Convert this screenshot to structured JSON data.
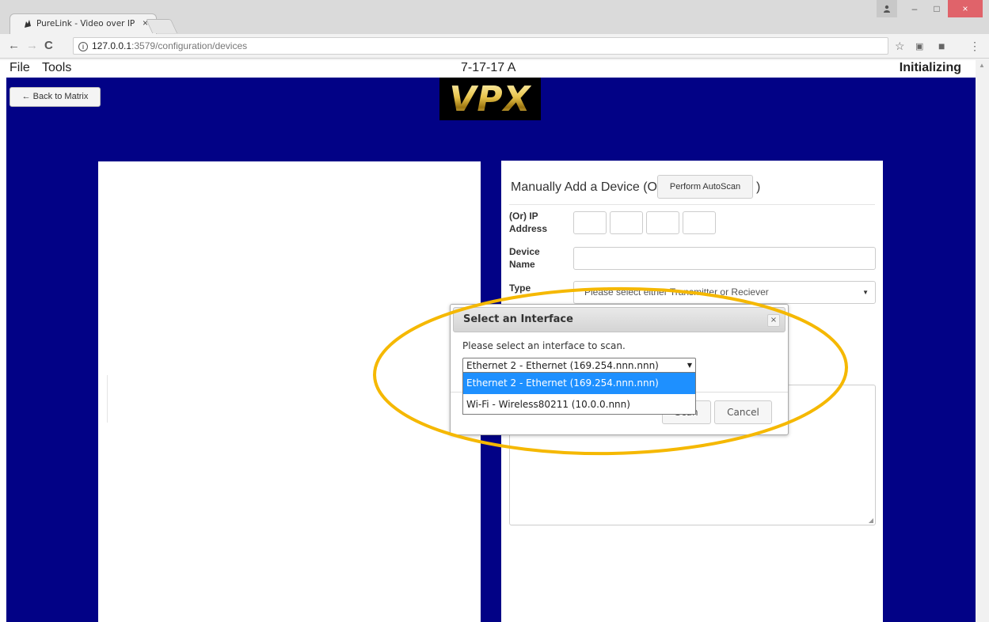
{
  "browser": {
    "tab_title": "PureLink - Video over IP",
    "tab_close": "×",
    "url_host": "127.0.0.1",
    "url_path": ":3579/configuration/devices",
    "url_info_icon": "i",
    "window_min": "–",
    "window_max": "□",
    "window_close": "×"
  },
  "app": {
    "menu": [
      "File",
      "Tools"
    ],
    "version": "7-17-17 A",
    "status": "Initializing",
    "back_button": "← Back to Matrix",
    "logo_text": "VPX"
  },
  "add_device": {
    "title": "Manually Add a Device (Or",
    "autoscan_button": "Perform AutoScan",
    "title_close": ")",
    "ip_label_line1": "(Or) IP",
    "ip_label_line2": "Address",
    "name_label_line1": "Device",
    "name_label_line2": "Name",
    "type_label": "Type",
    "type_placeholder": "Please select either Transmitter or Reciever"
  },
  "dialog": {
    "title": "Select an Interface",
    "close": "×",
    "message": "Please select an interface to scan.",
    "selected_value": "Ethernet 2 - Ethernet (169.254.nnn.nnn)",
    "options": [
      "Ethernet 2 - Ethernet (169.254.nnn.nnn)",
      "Wi-Fi - Wireless80211 (10.0.0.nnn)"
    ],
    "scan_button": "Scan",
    "cancel_button": "Cancel"
  },
  "colors": {
    "main_background": "#020286",
    "highlight_ellipse": "#f5b800",
    "selected_option": "#1e90ff"
  }
}
